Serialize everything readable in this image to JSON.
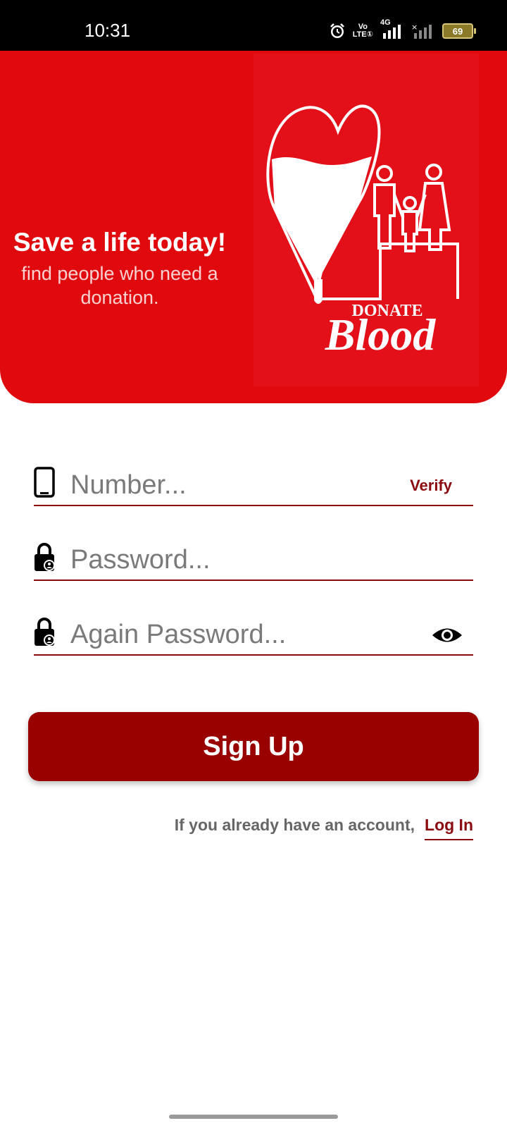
{
  "status_bar": {
    "time": "10:31",
    "volte_top": "Vo",
    "volte_bottom": "LTE①",
    "network_type": "4G",
    "battery_level": "69"
  },
  "hero": {
    "title": "Save a life today!",
    "subtitle": "find people who need a donation.",
    "logo_top": "DONATE",
    "logo_main": "Blood"
  },
  "form": {
    "number_placeholder": "Number...",
    "verify_label": "Verify",
    "password_placeholder": "Password...",
    "again_password_placeholder": "Again Password..."
  },
  "signup_label": "Sign Up",
  "login_prompt": "If you already have an account,",
  "login_link": "Log In",
  "colors": {
    "hero_red": "#e00a0e",
    "button_dark_red": "#990000",
    "accent": "#8b0c10"
  },
  "icons": [
    "alarm-icon",
    "signal-icon",
    "battery-icon",
    "phone-icon",
    "lock-icon",
    "eye-icon"
  ]
}
